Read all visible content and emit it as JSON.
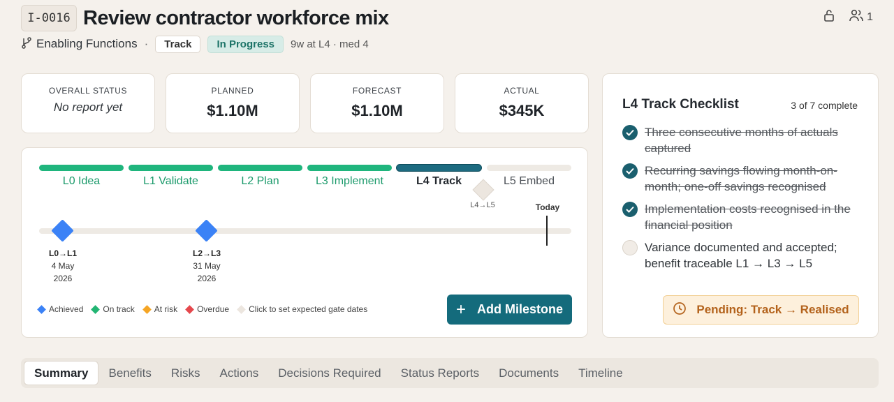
{
  "header": {
    "id": "I-0016",
    "title": "Review contractor workforce mix",
    "lock_icon": "lock-open-icon",
    "members_count": "1"
  },
  "meta": {
    "workstream": "Enabling Functions",
    "separator": "·",
    "stage_pill": "Track",
    "status_pill": "In Progress",
    "duration": "9w at L4 · med 4"
  },
  "kpis": [
    {
      "label": "OVERALL STATUS",
      "value": "No report yet"
    },
    {
      "label": "PLANNED",
      "value": "$1.10M"
    },
    {
      "label": "FORECAST",
      "value": "$1.10M"
    },
    {
      "label": "ACTUAL",
      "value": "$345K"
    }
  ],
  "stages": [
    {
      "label": "L0 Idea",
      "state": "done"
    },
    {
      "label": "L1 Validate",
      "state": "done"
    },
    {
      "label": "L2 Plan",
      "state": "done"
    },
    {
      "label": "L3 Implement",
      "state": "done"
    },
    {
      "label": "L4 Track",
      "state": "current"
    },
    {
      "label": "L5 Embed",
      "state": "todo"
    }
  ],
  "timeline": {
    "pending_gate_label": "L4→L5",
    "today_label": "Today",
    "milestones": [
      {
        "code": "L0→L1",
        "date": "4 May",
        "year": "2026"
      },
      {
        "code": "L2→L3",
        "date": "31 May",
        "year": "2026"
      }
    ]
  },
  "legend": {
    "achieved": "Achieved",
    "on_track": "On track",
    "at_risk": "At risk",
    "overdue": "Overdue",
    "hint": "Click to set expected gate dates"
  },
  "colors": {
    "achieved": "#3b82f6",
    "on_track": "#22b573",
    "at_risk": "#f5a524",
    "overdue": "#e5484d",
    "unset": "#ece6df"
  },
  "add_milestone_label": "Add Milestone",
  "checklist": {
    "title": "L4 Track Checklist",
    "count": "3 of 7 complete",
    "items": [
      {
        "text": "Three consecutive months of actuals captured",
        "done": true
      },
      {
        "text": "Recurring savings flowing month-on-month; one-off savings recognised",
        "done": true
      },
      {
        "text": "Implementation costs recognised in the financial position",
        "done": true
      },
      {
        "text": "Variance documented and accepted; benefit traceable L1 → L3 → L5",
        "done": false
      }
    ],
    "pending_label": "Pending: Track → Realised"
  },
  "tabs": [
    "Summary",
    "Benefits",
    "Risks",
    "Actions",
    "Decisions Required",
    "Status Reports",
    "Documents",
    "Timeline"
  ]
}
